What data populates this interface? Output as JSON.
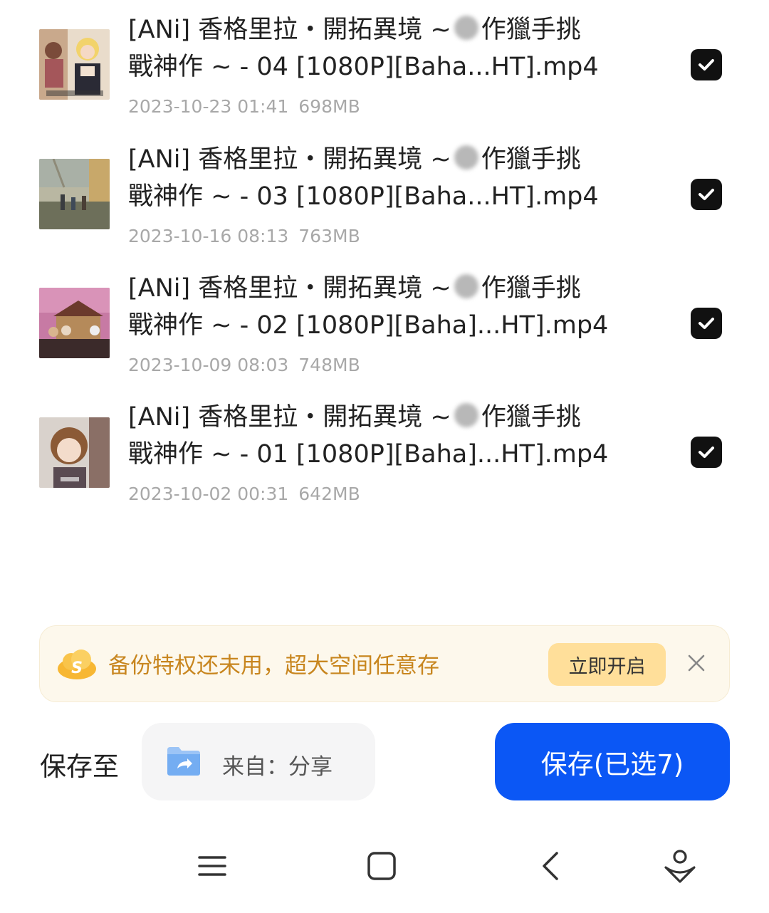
{
  "files": [
    {
      "name_line1_before": "[ANi] 香格里拉・開拓異境 ~",
      "name_line1_after": "作獵手挑",
      "name_line2": "戰神作 ~ - 04 [1080P][Baha...HT].mp4",
      "date": "2023-10-23 01:41",
      "size": "698MB",
      "checked": true,
      "thumb_icon": "anime-thumbnail-icon"
    },
    {
      "name_line1_before": "[ANi] 香格里拉・開拓異境 ~",
      "name_line1_after": "作獵手挑",
      "name_line2": "戰神作 ~ - 03 [1080P][Baha...HT].mp4",
      "date": "2023-10-16 08:13",
      "size": "763MB",
      "checked": true,
      "thumb_icon": "anime-thumbnail-icon"
    },
    {
      "name_line1_before": "[ANi] 香格里拉・開拓異境 ~",
      "name_line1_after": "作獵手挑",
      "name_line2": "戰神作 ~ - 02 [1080P][Baha]...HT].mp4",
      "date": "2023-10-09 08:03",
      "size": "748MB",
      "checked": true,
      "thumb_icon": "anime-thumbnail-icon"
    },
    {
      "name_line1_before": "[ANi] 香格里拉・開拓異境 ~",
      "name_line1_after": "作獵手挑",
      "name_line2": "戰神作 ~ - 01 [1080P][Baha]...HT].mp4",
      "date": "2023-10-02 00:31",
      "size": "642MB",
      "checked": true,
      "thumb_icon": "anime-thumbnail-icon"
    }
  ],
  "promo": {
    "text": "备份特权还未用，超大空间任意存",
    "button_label": "立即开启",
    "icon": "cloud-s-icon",
    "text_color": "#c8861f",
    "button_color": "#ffdf9a"
  },
  "save_bar": {
    "label": "保存至",
    "destination": "来自：分享",
    "destination_icon": "shared-folder-icon",
    "save_button_label": "保存(已选7)",
    "accent_color": "#0b57f5"
  },
  "nav": {
    "icons": [
      "menu-icon",
      "home-icon",
      "back-icon",
      "assistant-icon"
    ]
  }
}
